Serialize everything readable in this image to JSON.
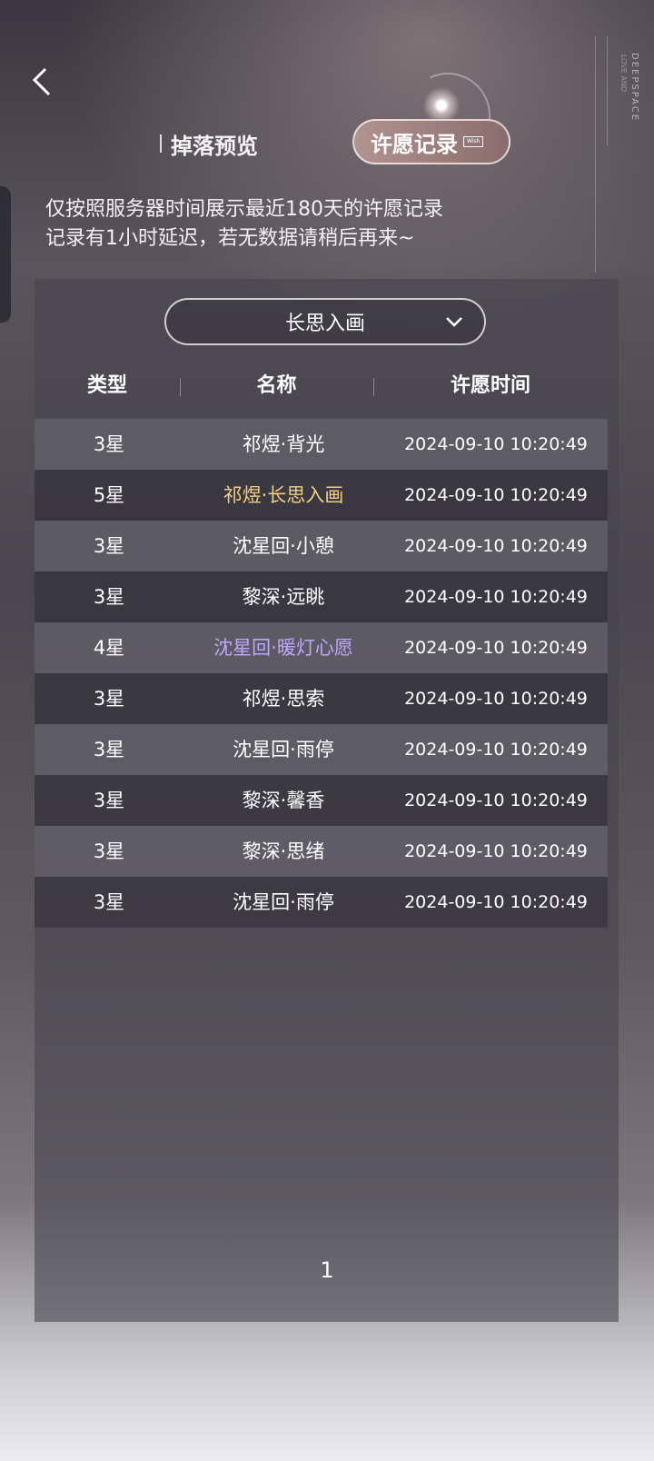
{
  "brand": {
    "text": "DEEPSPACE",
    "sub": "LOVE AND"
  },
  "tabs": [
    {
      "label": "掉落预览",
      "active": false
    },
    {
      "label": "许愿记录",
      "active": true,
      "tag": "Wish"
    }
  ],
  "notice": {
    "line1": "仅按照服务器时间展示最近180天的许愿记录",
    "line2": "记录有1小时延迟，若无数据请稍后再来~"
  },
  "pool_select": {
    "value": "长思入画"
  },
  "table": {
    "headers": [
      "类型",
      "名称",
      "许愿时间"
    ],
    "rows": [
      {
        "type": "3星",
        "name": "祁煜·背光",
        "time": "2024-09-10 10:20:49",
        "rarity": "3"
      },
      {
        "type": "5星",
        "name": "祁煜·长思入画",
        "time": "2024-09-10 10:20:49",
        "rarity": "5"
      },
      {
        "type": "3星",
        "name": "沈星回·小憩",
        "time": "2024-09-10 10:20:49",
        "rarity": "3"
      },
      {
        "type": "3星",
        "name": "黎深·远眺",
        "time": "2024-09-10 10:20:49",
        "rarity": "3"
      },
      {
        "type": "4星",
        "name": "沈星回·暖灯心愿",
        "time": "2024-09-10 10:20:49",
        "rarity": "4"
      },
      {
        "type": "3星",
        "name": "祁煜·思索",
        "time": "2024-09-10 10:20:49",
        "rarity": "3"
      },
      {
        "type": "3星",
        "name": "沈星回·雨停",
        "time": "2024-09-10 10:20:49",
        "rarity": "3"
      },
      {
        "type": "3星",
        "name": "黎深·馨香",
        "time": "2024-09-10 10:20:49",
        "rarity": "3"
      },
      {
        "type": "3星",
        "name": "黎深·思绪",
        "time": "2024-09-10 10:20:49",
        "rarity": "3"
      },
      {
        "type": "3星",
        "name": "沈星回·雨停",
        "time": "2024-09-10 10:20:49",
        "rarity": "3"
      }
    ]
  },
  "pagination": {
    "current": "1"
  },
  "colors": {
    "five_star": "#f0cf85",
    "four_star": "#bba8ff",
    "three_star": "#ffffff"
  }
}
